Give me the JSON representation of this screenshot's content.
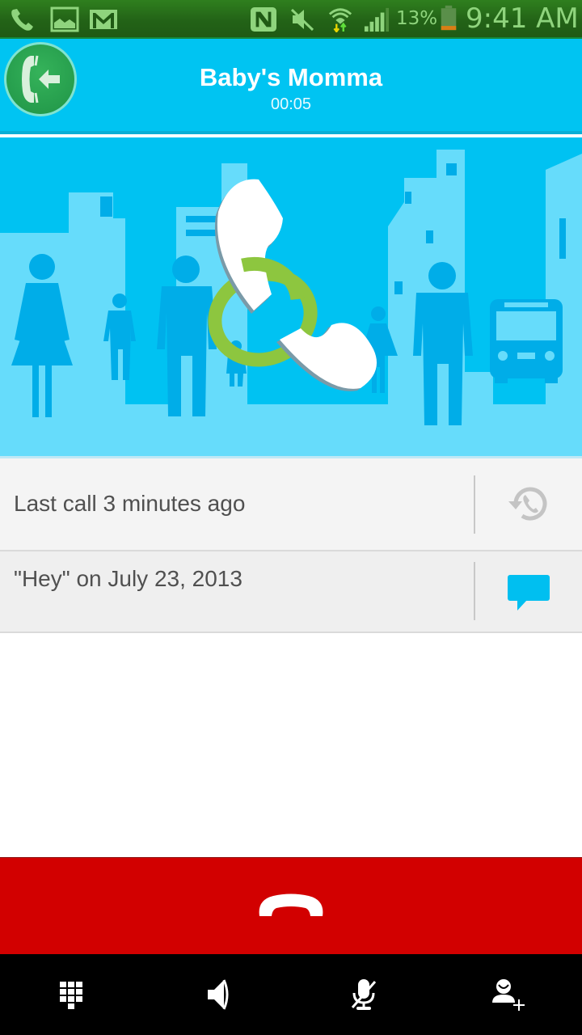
{
  "status_bar": {
    "notification_icons": [
      "missed-call-icon",
      "gallery-icon",
      "gmail-icon"
    ],
    "system_icons": [
      "nfc-icon",
      "mute-icon",
      "wifi-icon",
      "signal-icon",
      "battery-icon"
    ],
    "battery_percent": "13%",
    "time": "9:41 AM",
    "colors": {
      "background": "#236317",
      "icon": "#8fd47d",
      "battery_fill": "#d97e14"
    }
  },
  "call": {
    "contact_name": "Baby's Momma",
    "duration": "00:05",
    "direction_icon": "incoming-call-icon",
    "colors": {
      "header": "#00c4f2",
      "badge": "#1f9447"
    }
  },
  "illustration": {
    "description": "city-skyline-with-people-and-phone-logo",
    "colors": {
      "sky": "#00c2f2",
      "buildings": "#66dcfb",
      "figures": "#00ade8",
      "handset": "#ffffff",
      "ring": "#8dc63f"
    }
  },
  "info_rows": [
    {
      "text": "Last call 3 minutes ago",
      "action_icon": "call-history-icon",
      "action_color": "#c4c4c4"
    },
    {
      "text": "\"Hey\" on July 23, 2013",
      "action_icon": "message-icon",
      "action_color": "#00bff0"
    }
  ],
  "end_call": {
    "icon": "end-call-icon",
    "color": "#d20000"
  },
  "toolbar": {
    "items": [
      {
        "name": "dialpad",
        "icon": "dialpad-icon"
      },
      {
        "name": "speaker",
        "icon": "speaker-icon"
      },
      {
        "name": "mute",
        "icon": "mic-mute-icon"
      },
      {
        "name": "add-call",
        "icon": "add-person-icon"
      }
    ]
  }
}
